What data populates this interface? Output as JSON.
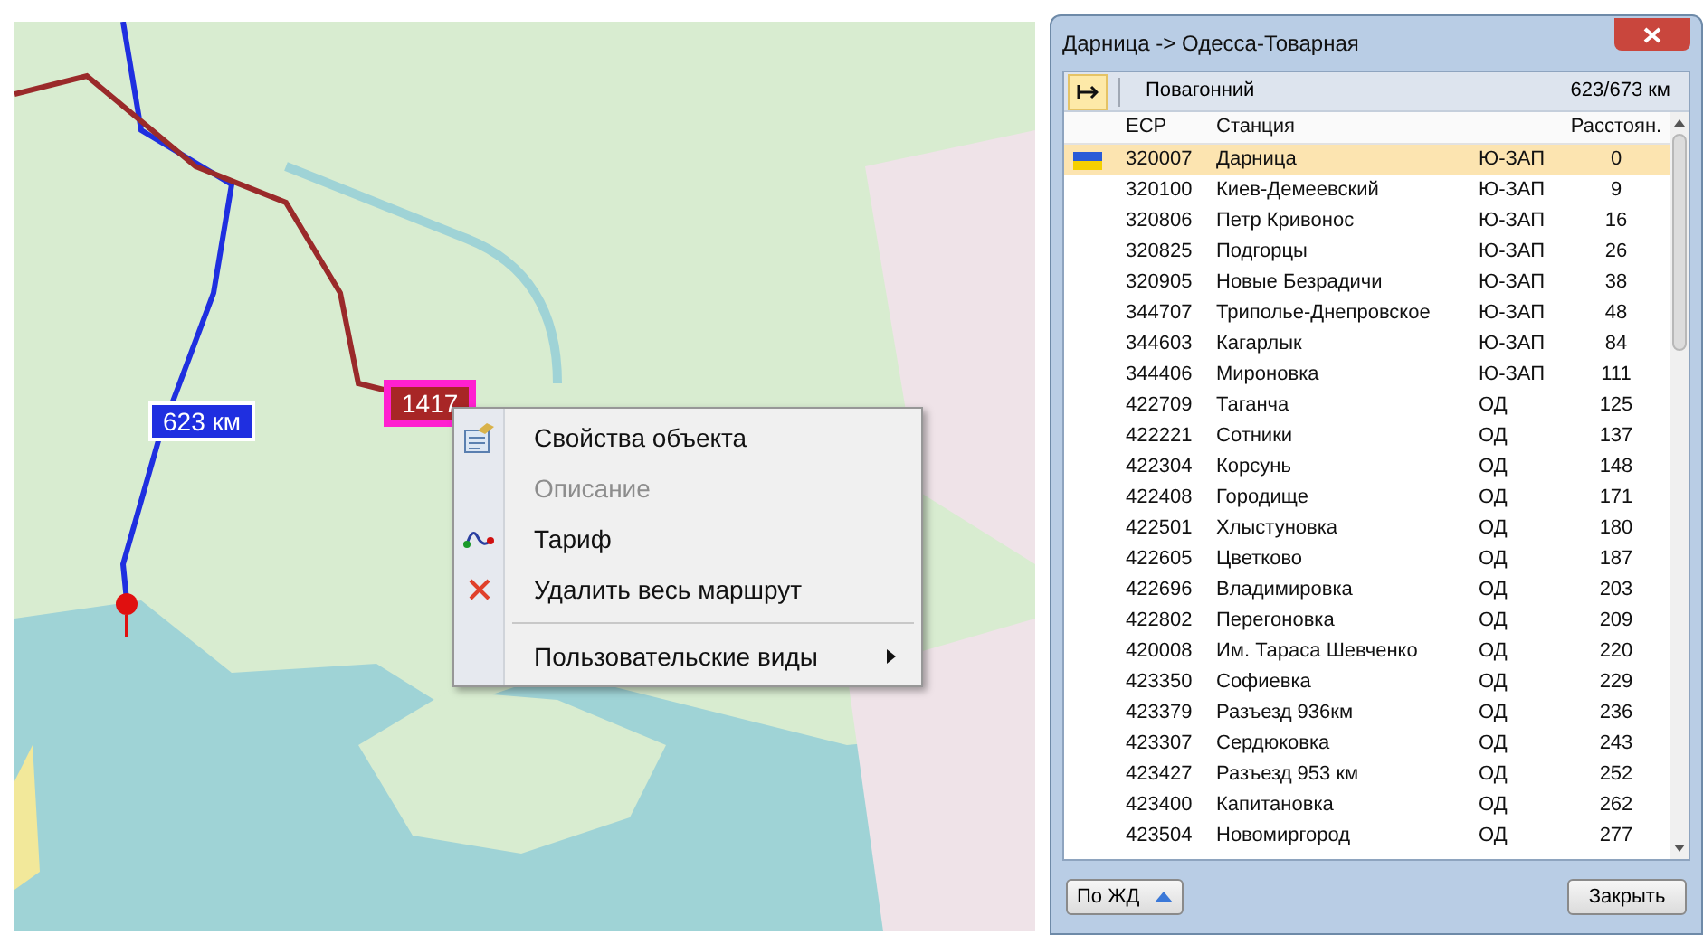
{
  "map": {
    "kind": "picture",
    "route_labels": [
      {
        "text": "623 км",
        "kind": "blue"
      },
      {
        "text": "1417",
        "kind": "red"
      }
    ]
  },
  "context_menu": {
    "items": [
      {
        "label": "Свойства объекта",
        "disabled": false,
        "kind": "properties"
      },
      {
        "label": "Описание",
        "disabled": true,
        "kind": "plain"
      },
      {
        "label": "Тариф",
        "disabled": false,
        "kind": "tariff"
      },
      {
        "label": "Удалить весь маршрут",
        "disabled": false,
        "kind": "delete"
      },
      {
        "label": "Пользовательские виды",
        "disabled": false,
        "kind": "submenu"
      }
    ]
  },
  "window": {
    "title": "Дарница -> Одесса-Товарная",
    "toolbar": {
      "mode": "Повагонний",
      "distance": "623/673 км"
    },
    "table": {
      "columns": [
        "ЕСР",
        "Станция",
        "Расстоян."
      ],
      "rows": [
        {
          "code": "320007",
          "station": "Дарница",
          "road": "Ю-ЗАП",
          "distance": "0",
          "selected": true,
          "flag": true
        },
        {
          "code": "320100",
          "station": "Киев-Демеевский",
          "road": "Ю-ЗАП",
          "distance": "9",
          "selected": false,
          "flag": false
        },
        {
          "code": "320806",
          "station": "Петр Кривонос",
          "road": "Ю-ЗАП",
          "distance": "16",
          "selected": false,
          "flag": false
        },
        {
          "code": "320825",
          "station": "Подгорцы",
          "road": "Ю-ЗАП",
          "distance": "26",
          "selected": false,
          "flag": false
        },
        {
          "code": "320905",
          "station": "Новые Безрадичи",
          "road": "Ю-ЗАП",
          "distance": "38",
          "selected": false,
          "flag": false
        },
        {
          "code": "344707",
          "station": "Триполье-Днепровское",
          "road": "Ю-ЗАП",
          "distance": "48",
          "selected": false,
          "flag": false
        },
        {
          "code": "344603",
          "station": "Кагарлык",
          "road": "Ю-ЗАП",
          "distance": "84",
          "selected": false,
          "flag": false
        },
        {
          "code": "344406",
          "station": "Мироновка",
          "road": "Ю-ЗАП",
          "distance": "111",
          "selected": false,
          "flag": false
        },
        {
          "code": "422709",
          "station": "Таганча",
          "road": "ОД",
          "distance": "125",
          "selected": false,
          "flag": false
        },
        {
          "code": "422221",
          "station": "Сотники",
          "road": "ОД",
          "distance": "137",
          "selected": false,
          "flag": false
        },
        {
          "code": "422304",
          "station": "Корсунь",
          "road": "ОД",
          "distance": "148",
          "selected": false,
          "flag": false
        },
        {
          "code": "422408",
          "station": "Городище",
          "road": "ОД",
          "distance": "171",
          "selected": false,
          "flag": false
        },
        {
          "code": "422501",
          "station": "Хлыстуновка",
          "road": "ОД",
          "distance": "180",
          "selected": false,
          "flag": false
        },
        {
          "code": "422605",
          "station": "Цветково",
          "road": "ОД",
          "distance": "187",
          "selected": false,
          "flag": false
        },
        {
          "code": "422696",
          "station": "Владимировка",
          "road": "ОД",
          "distance": "203",
          "selected": false,
          "flag": false
        },
        {
          "code": "422802",
          "station": "Перегоновка",
          "road": "ОД",
          "distance": "209",
          "selected": false,
          "flag": false
        },
        {
          "code": "420008",
          "station": "Им. Тараса Шевченко",
          "road": "ОД",
          "distance": "220",
          "selected": false,
          "flag": false
        },
        {
          "code": "423350",
          "station": "Софиевка",
          "road": "ОД",
          "distance": "229",
          "selected": false,
          "flag": false
        },
        {
          "code": "423379",
          "station": "Разъезд 936км",
          "road": "ОД",
          "distance": "236",
          "selected": false,
          "flag": false
        },
        {
          "code": "423307",
          "station": "Сердюковка",
          "road": "ОД",
          "distance": "243",
          "selected": false,
          "flag": false
        },
        {
          "code": "423427",
          "station": "Разъезд 953 км",
          "road": "ОД",
          "distance": "252",
          "selected": false,
          "flag": false
        },
        {
          "code": "423400",
          "station": "Капитановка",
          "road": "ОД",
          "distance": "262",
          "selected": false,
          "flag": false
        },
        {
          "code": "423504",
          "station": "Новомиргород",
          "road": "ОД",
          "distance": "277",
          "selected": false,
          "flag": false
        }
      ]
    },
    "buttons": {
      "dropdown": "По ЖД",
      "close": "Закрыть"
    }
  }
}
